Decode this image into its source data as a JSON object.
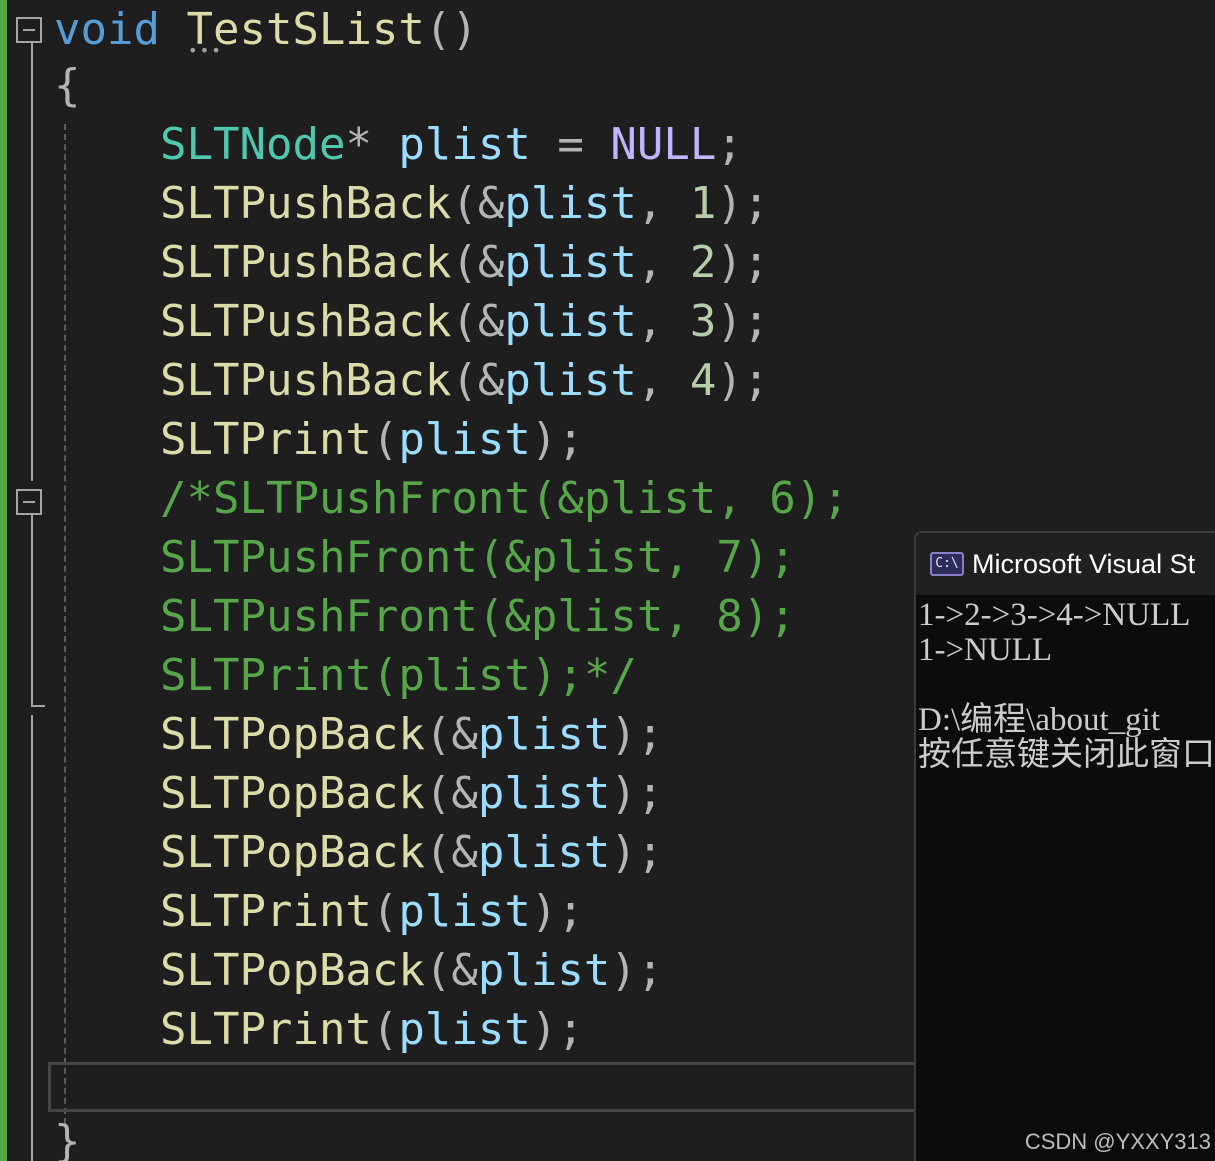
{
  "editor": {
    "colors": {
      "background": "#1e1e1e",
      "keyword": "#569cd6",
      "function": "#dcdcaa",
      "type": "#4ec9b0",
      "variable": "#9cdcfe",
      "number": "#b5cea8",
      "macro": "#beb7ff",
      "comment": "#57a64a",
      "change_bar": "#57a64a"
    },
    "lines": [
      {
        "tokens": [
          [
            "kw",
            "void"
          ],
          [
            "pun",
            " "
          ],
          [
            "fn",
            "TestSList"
          ],
          [
            "pun",
            "()"
          ]
        ]
      },
      {
        "tokens": [
          [
            "pun",
            "{"
          ]
        ]
      },
      {
        "indent": true,
        "tokens": [
          [
            "ty",
            "SLTNode"
          ],
          [
            "op",
            "* "
          ],
          [
            "var",
            "plist"
          ],
          [
            "op",
            " = "
          ],
          [
            "macro",
            "NULL"
          ],
          [
            "pun",
            ";"
          ]
        ]
      },
      {
        "indent": true,
        "tokens": [
          [
            "fn",
            "SLTPushBack"
          ],
          [
            "pun",
            "(&"
          ],
          [
            "var",
            "plist"
          ],
          [
            "pun",
            ", "
          ],
          [
            "num",
            "1"
          ],
          [
            "pun",
            ");"
          ]
        ]
      },
      {
        "indent": true,
        "tokens": [
          [
            "fn",
            "SLTPushBack"
          ],
          [
            "pun",
            "(&"
          ],
          [
            "var",
            "plist"
          ],
          [
            "pun",
            ", "
          ],
          [
            "num",
            "2"
          ],
          [
            "pun",
            ");"
          ]
        ]
      },
      {
        "indent": true,
        "tokens": [
          [
            "fn",
            "SLTPushBack"
          ],
          [
            "pun",
            "(&"
          ],
          [
            "var",
            "plist"
          ],
          [
            "pun",
            ", "
          ],
          [
            "num",
            "3"
          ],
          [
            "pun",
            ");"
          ]
        ]
      },
      {
        "indent": true,
        "tokens": [
          [
            "fn",
            "SLTPushBack"
          ],
          [
            "pun",
            "(&"
          ],
          [
            "var",
            "plist"
          ],
          [
            "pun",
            ", "
          ],
          [
            "num",
            "4"
          ],
          [
            "pun",
            ");"
          ]
        ]
      },
      {
        "indent": true,
        "tokens": [
          [
            "fn",
            "SLTPrint"
          ],
          [
            "pun",
            "("
          ],
          [
            "var",
            "plist"
          ],
          [
            "pun",
            ");"
          ]
        ]
      },
      {
        "indent": true,
        "tokens": [
          [
            "com",
            "/*SLTPushFront(&plist, 6);"
          ]
        ]
      },
      {
        "indent": true,
        "tokens": [
          [
            "com",
            "SLTPushFront(&plist, 7);"
          ]
        ]
      },
      {
        "indent": true,
        "tokens": [
          [
            "com",
            "SLTPushFront(&plist, 8);"
          ]
        ]
      },
      {
        "indent": true,
        "tokens": [
          [
            "com",
            "SLTPrint(plist);*/"
          ]
        ]
      },
      {
        "indent": true,
        "tokens": [
          [
            "fn",
            "SLTPopBack"
          ],
          [
            "pun",
            "(&"
          ],
          [
            "var",
            "plist"
          ],
          [
            "pun",
            ");"
          ]
        ]
      },
      {
        "indent": true,
        "tokens": [
          [
            "fn",
            "SLTPopBack"
          ],
          [
            "pun",
            "(&"
          ],
          [
            "var",
            "plist"
          ],
          [
            "pun",
            ");"
          ]
        ]
      },
      {
        "indent": true,
        "tokens": [
          [
            "fn",
            "SLTPopBack"
          ],
          [
            "pun",
            "(&"
          ],
          [
            "var",
            "plist"
          ],
          [
            "pun",
            ");"
          ]
        ]
      },
      {
        "indent": true,
        "tokens": [
          [
            "fn",
            "SLTPrint"
          ],
          [
            "pun",
            "("
          ],
          [
            "var",
            "plist"
          ],
          [
            "pun",
            ");"
          ]
        ]
      },
      {
        "indent": true,
        "tokens": [
          [
            "fn",
            "SLTPopBack"
          ],
          [
            "pun",
            "(&"
          ],
          [
            "var",
            "plist"
          ],
          [
            "pun",
            ");"
          ]
        ]
      },
      {
        "indent": true,
        "tokens": [
          [
            "fn",
            "SLTPrint"
          ],
          [
            "pun",
            "("
          ],
          [
            "var",
            "plist"
          ],
          [
            "pun",
            ");"
          ]
        ]
      },
      {
        "tokens": []
      },
      {
        "tokens": [
          [
            "pun",
            "}"
          ]
        ]
      }
    ]
  },
  "console": {
    "icon": "C:\\",
    "title": "Microsoft Visual St",
    "output": [
      "1->2->3->4->NULL",
      "1->NULL",
      "",
      "D:\\编程\\about_git",
      "按任意键关闭此窗口"
    ]
  },
  "watermark": "CSDN @YXXY313"
}
